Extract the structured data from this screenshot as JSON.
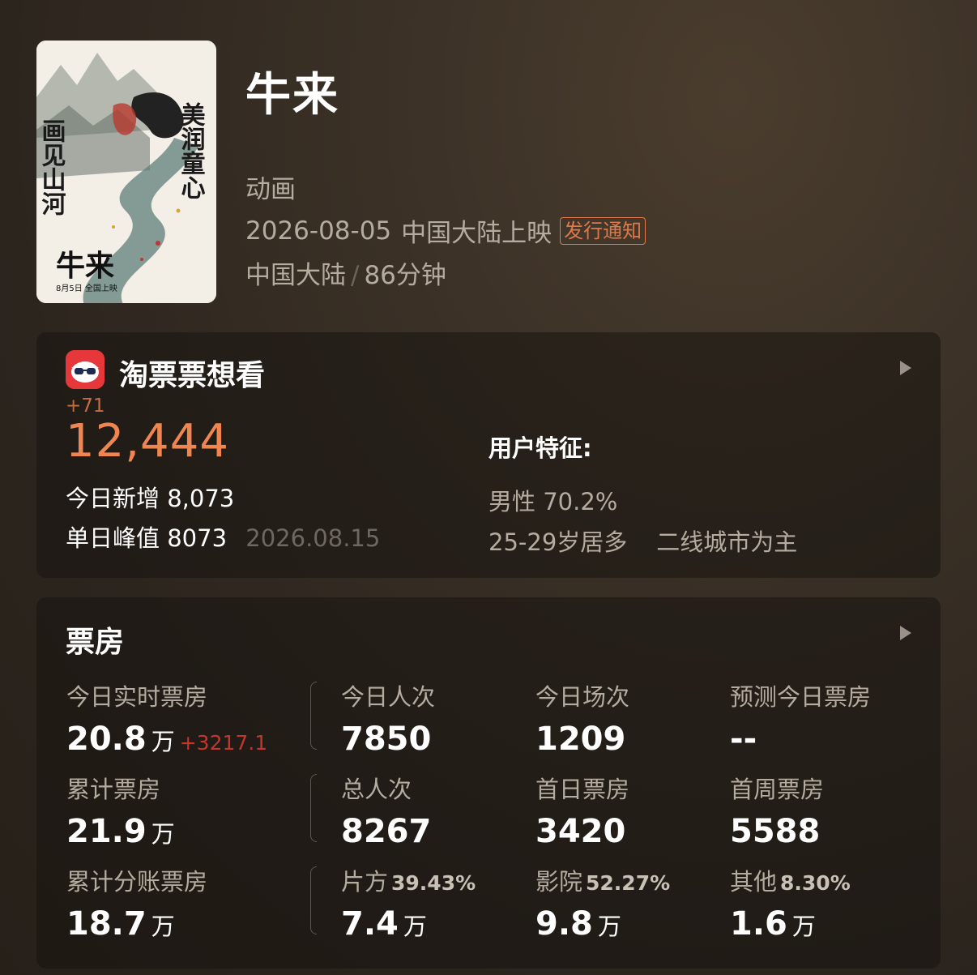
{
  "movie": {
    "title": "牛来",
    "genre": "动画",
    "release_date": "2026-08-05",
    "release_region": "中国大陆上映",
    "release_badge": "发行通知",
    "region": "中国大陆",
    "region_sep": "/",
    "duration": "86分钟",
    "poster": {
      "slogan_left": "画见山河",
      "slogan_right": "美润童心",
      "logo": "牛来",
      "date_line": "8月5日  全国上映"
    }
  },
  "want_to_see": {
    "title": "淘票票想看",
    "icon": "taopiaopiao-app-icon",
    "delta": "+71",
    "total": "12,444",
    "today_label": "今日新增",
    "today_value": "8,073",
    "peak_label": "单日峰值",
    "peak_value": "8073",
    "peak_date": "2026.08.15",
    "user_title": "用户特征:",
    "gender": "男性 70.2%",
    "age": "25-29岁居多",
    "city": "二线城市为主"
  },
  "box_office": {
    "title": "票房",
    "realtime": {
      "label": "今日实时票房",
      "value": "20.8",
      "unit": "万",
      "delta": "+3217.1"
    },
    "today_viewers": {
      "label": "今日人次",
      "value": "7850"
    },
    "today_shows": {
      "label": "今日场次",
      "value": "1209"
    },
    "forecast": {
      "label": "预测今日票房",
      "value": "--"
    },
    "cumulative": {
      "label": "累计票房",
      "value": "21.9",
      "unit": "万"
    },
    "total_viewers": {
      "label": "总人次",
      "value": "8267"
    },
    "first_day": {
      "label": "首日票房",
      "value": "3420"
    },
    "first_week": {
      "label": "首周票房",
      "value": "5588"
    },
    "split": {
      "label": "累计分账票房",
      "value": "18.7",
      "unit": "万"
    },
    "producer": {
      "label": "片方",
      "pct": "39.43%",
      "value": "7.4",
      "unit": "万"
    },
    "cinema": {
      "label": "影院",
      "pct": "52.27%",
      "value": "9.8",
      "unit": "万"
    },
    "other": {
      "label": "其他",
      "pct": "8.30%",
      "value": "1.6",
      "unit": "万"
    }
  },
  "colors": {
    "accent_orange": "#ef8652",
    "badge_orange": "#e0784a",
    "delta_red": "#c4352e",
    "app_red": "#e6383a"
  }
}
